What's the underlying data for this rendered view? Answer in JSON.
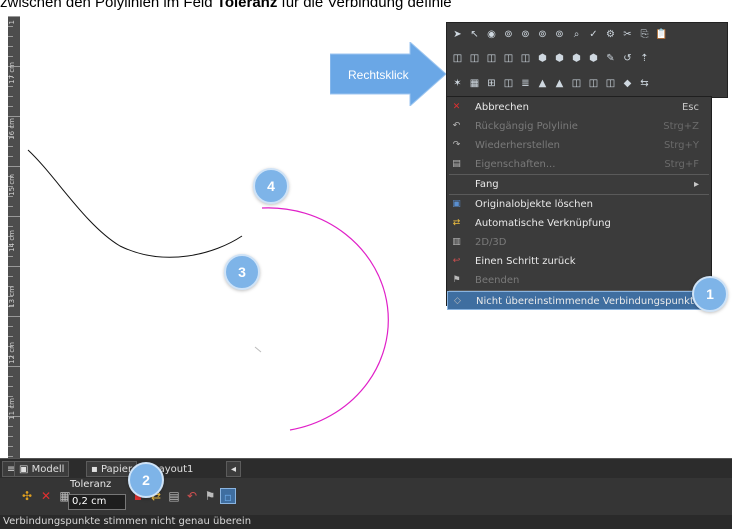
{
  "caption": {
    "prefix": "zwischen den Polylinien im Feld ",
    "bold": "Toleranz",
    "suffix": " für die Verbindung definie"
  },
  "ruler": {
    "labels": [
      "1",
      "17 cm",
      "16 cm",
      "15 cm",
      "14 cm",
      "13 cm",
      "12 cm",
      "11 cm"
    ]
  },
  "callout": {
    "arrow_label": "Rechtsklick",
    "arrow_color": "#6aa7e6"
  },
  "badges": {
    "b1": "1",
    "b2": "2",
    "b3": "3",
    "b4": "4"
  },
  "toolbar": {
    "row1_icons": [
      "select-arrow-icon",
      "pointer-icon",
      "circle-node-icon",
      "node-icon",
      "node-icon",
      "node-icon",
      "node-icon",
      "zoom-icon",
      "check-icon",
      "gear-icon",
      "scissors-icon",
      "copy-icon",
      "paste-icon"
    ],
    "row2_icons": [
      "shape-icon",
      "shape-icon",
      "shape-icon",
      "shape-icon",
      "shape-icon",
      "cube-icon",
      "cube-icon",
      "cube-icon",
      "cube-icon",
      "pen-icon",
      "arrow-icon",
      "up-icon"
    ],
    "row3_icons": [
      "star-icon",
      "table-icon",
      "grid-icon",
      "shape-icon",
      "list-icon",
      "mountain-icon",
      "mountain-icon",
      "shape-icon",
      "shape-icon",
      "shape-icon",
      "tag-icon",
      "arrows-icon"
    ]
  },
  "menu": {
    "items": [
      {
        "label": "Abbrechen",
        "shortcut": "Esc",
        "icon": "close-icon",
        "disabled": false
      },
      {
        "label": "Rückgängig Polylinie",
        "shortcut": "Strg+Z",
        "icon": "undo-icon",
        "disabled": true
      },
      {
        "label": "Wiederherstellen",
        "shortcut": "Strg+Y",
        "icon": "redo-icon",
        "disabled": true
      },
      {
        "label": "Eigenschaften...",
        "shortcut": "Strg+F",
        "icon": "properties-icon",
        "disabled": true
      },
      {
        "label": "Fang",
        "shortcut": "",
        "icon": "",
        "disabled": false,
        "submenu": true
      },
      {
        "label": "Originalobjekte löschen",
        "shortcut": "",
        "icon": "delete-original-icon",
        "disabled": false
      },
      {
        "label": "Automatische Verknüpfung",
        "shortcut": "",
        "icon": "auto-link-icon",
        "disabled": false
      },
      {
        "label": "2D/3D",
        "shortcut": "",
        "icon": "dimension-icon",
        "disabled": true
      },
      {
        "label": "Einen Schritt zurück",
        "shortcut": "",
        "icon": "step-back-icon",
        "disabled": false
      },
      {
        "label": "Beenden",
        "shortcut": "",
        "icon": "flag-icon",
        "disabled": true
      },
      {
        "label": "Nicht übereinstimmende Verbindungspunkte",
        "shortcut": "",
        "icon": "mismatch-icon",
        "disabled": false,
        "selected": true
      }
    ],
    "submenu_glyph": "▸"
  },
  "tabs": {
    "model": "Modell",
    "paper": "Papier",
    "layout": "Layout1",
    "scroll_glyph": "◂"
  },
  "tolerance": {
    "label": "Toleranz",
    "value": "0,2 cm"
  },
  "status": {
    "text": "Verbindungspunkte stimmen nicht genau überein"
  },
  "colors": {
    "arc": "#e020c8",
    "line": "#111111",
    "badge": "#7eb4e8",
    "highlight": "#3f6ea0"
  }
}
